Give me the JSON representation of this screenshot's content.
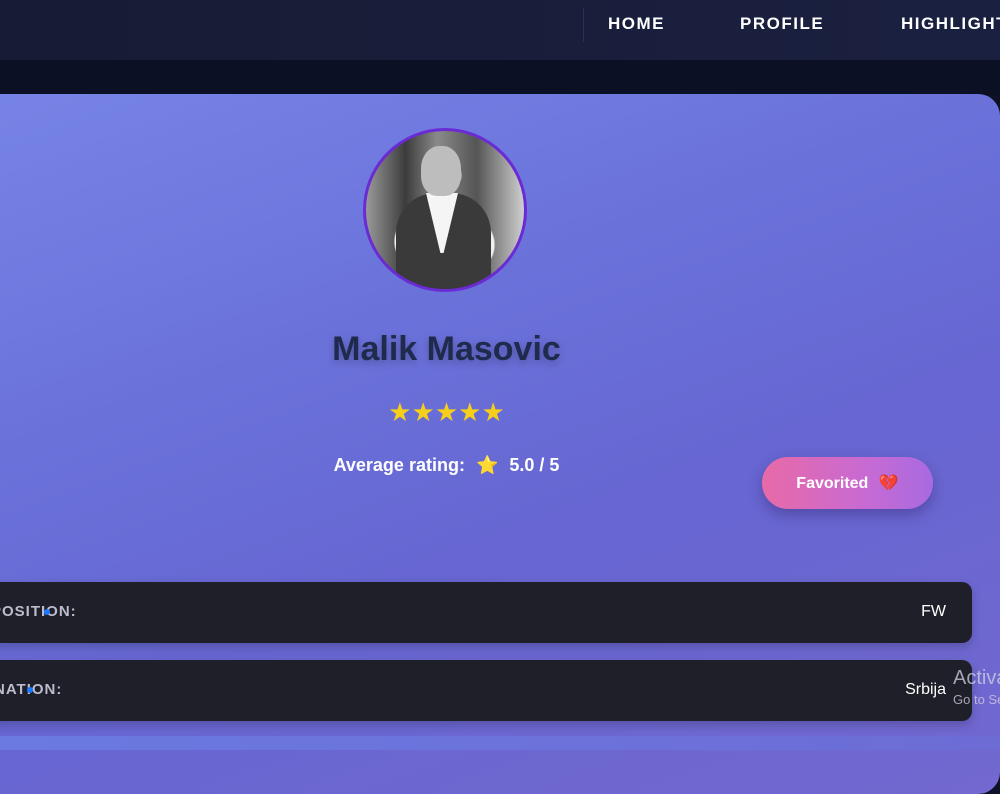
{
  "nav": {
    "home": "HOME",
    "profile": "PROFILE",
    "highlights": "HIGHLIGHTS"
  },
  "profile": {
    "name": "Malik Masovic",
    "stars": "★★★★★",
    "rating_label": "Average rating:",
    "rating_icon": "⭐",
    "rating_value": "5.0 / 5",
    "favorite_label": "Favorited",
    "favorite_icon": "💔"
  },
  "info_rows": [
    {
      "label": "POSITION:",
      "value": "FW"
    },
    {
      "label": "NATION:",
      "value": "Srbija"
    }
  ],
  "watermark": {
    "title": "Activate Windows",
    "subtitle": "Go to Settings to activate Windows."
  },
  "colors": {
    "accent": "#6a2bd4",
    "star": "#f6cf1a",
    "dot": "#1a7aff",
    "card_dark": "#1f1f29"
  }
}
